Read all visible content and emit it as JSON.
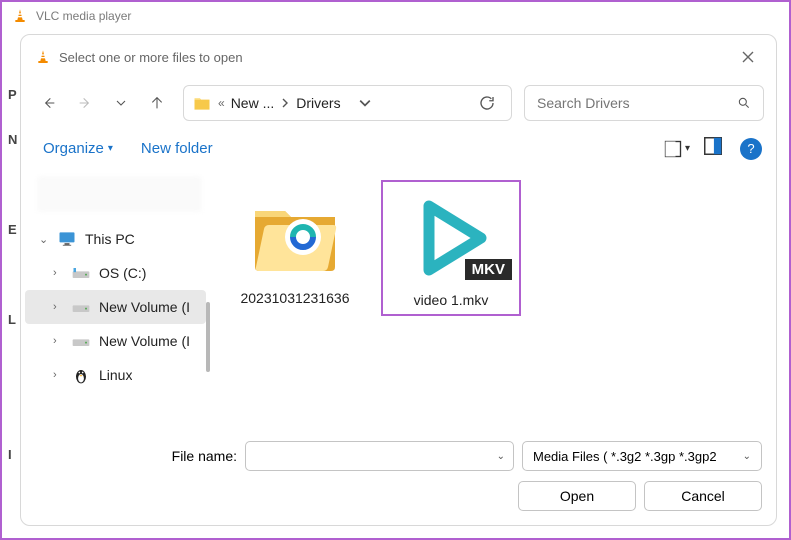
{
  "app": {
    "title": "VLC media player"
  },
  "dialog": {
    "title": "Select one or more files to open",
    "breadcrumb": {
      "prefix": "«",
      "seg1": "New ...",
      "seg2": "Drivers"
    },
    "search": {
      "placeholder": "Search Drivers"
    },
    "commands": {
      "organize": "Organize",
      "new_folder": "New folder"
    },
    "sidebar": {
      "this_pc": "This PC",
      "os_drive": "OS (C:)",
      "new_vol1": "New Volume (I",
      "new_vol2": "New Volume (I",
      "linux": "Linux"
    },
    "files": {
      "folder_name": "20231031231636",
      "video_name": "video 1.mkv",
      "mkv_badge": "MKV"
    },
    "footer": {
      "filename_label": "File name:",
      "filter": "Media Files ( *.3g2 *.3gp *.3gp2",
      "open": "Open",
      "cancel": "Cancel"
    }
  }
}
